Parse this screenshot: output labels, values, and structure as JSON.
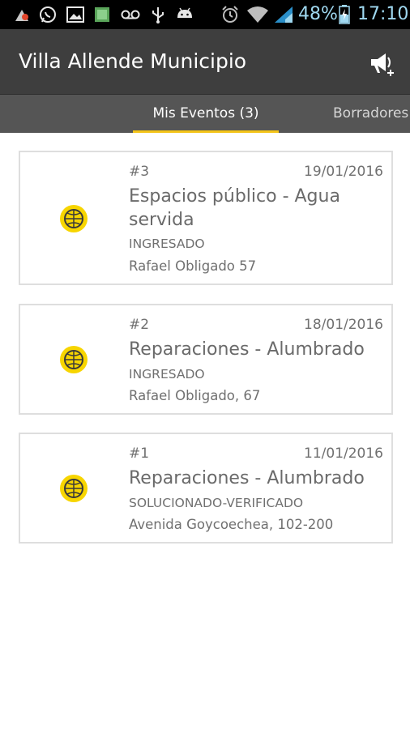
{
  "status_bar": {
    "battery_percent": "48%",
    "time": "17:10",
    "icons": [
      "fire-app-icon",
      "whatsapp-icon",
      "gallery-icon",
      "app-icon",
      "voicemail-icon",
      "usb-icon",
      "android-icon",
      "alarm-icon",
      "wifi-icon",
      "signal-icon",
      "battery-charging-icon"
    ]
  },
  "app_bar": {
    "title": "Villa Allende Municipio",
    "action_icon": "add-alert-megaphone-icon"
  },
  "tabs": [
    {
      "label": "Mis Eventos (3)",
      "selected": true
    },
    {
      "label": "Borradores",
      "selected": false
    }
  ],
  "colors": {
    "app_bar": "#3e3e3e",
    "tab_bar": "#555555",
    "tab_indicator": "#f3c419",
    "logo_yellow": "#f7d500"
  },
  "events": [
    {
      "number": "#3",
      "date": "19/01/2016",
      "title": "Espacios público - Agua servida",
      "status": "INGRESADO",
      "address": "Rafael Obligado 57",
      "icon": "municipio-logo-icon"
    },
    {
      "number": "#2",
      "date": "18/01/2016",
      "title": "Reparaciones - Alumbrado",
      "status": "INGRESADO",
      "address": "Rafael Obligado, 67",
      "icon": "municipio-logo-icon"
    },
    {
      "number": "#1",
      "date": "11/01/2016",
      "title": "Reparaciones - Alumbrado",
      "status": "SOLUCIONADO-VERIFICADO",
      "address": "Avenida Goycoechea, 102-200",
      "icon": "municipio-logo-icon"
    }
  ]
}
